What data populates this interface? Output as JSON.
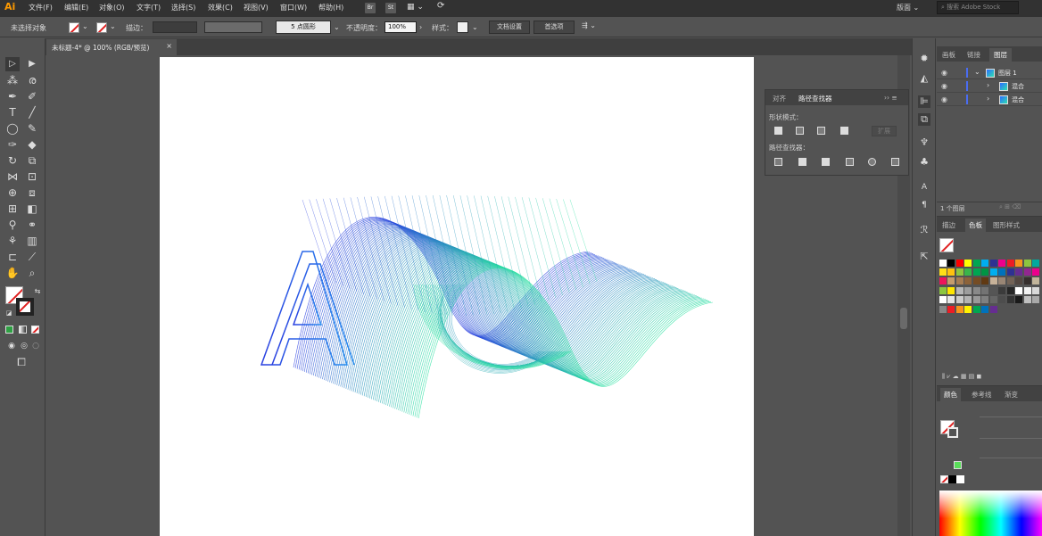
{
  "app": {
    "logo": "Ai"
  },
  "menu": {
    "items": [
      "文件(F)",
      "编辑(E)",
      "对象(O)",
      "文字(T)",
      "选择(S)",
      "效果(C)",
      "视图(V)",
      "窗口(W)",
      "帮助(H)"
    ],
    "badges": [
      "Br",
      "St"
    ],
    "workspace": "版面 ⌄",
    "search_placeholder": "搜索 Adobe Stock"
  },
  "control_bar": {
    "no_selection": "未选择对象",
    "stroke_label": "描边：",
    "brush_label": "5 点圆形",
    "opacity_label": "不透明度：",
    "opacity_value": "100%",
    "style_label": "样式：",
    "doc_setup_button": "文档设置",
    "prefs_button": "首选项"
  },
  "document": {
    "tab_title": "未标题-4* @ 100% (RGB/预览)",
    "close": "×",
    "gradient_start": "#2a3fe0",
    "gradient_end": "#29e0a0"
  },
  "pathfinder": {
    "tabs": [
      "对齐",
      "路径查找器"
    ],
    "shape_modes_label": "形状模式：",
    "pathfinders_label": "路径查找器：",
    "expand_button": "扩展",
    "menu_icons": "›› ≡"
  },
  "layers": {
    "tabs": [
      "画板",
      "链接",
      "图层"
    ],
    "rows": [
      {
        "name": "图层 1",
        "arrow": "⌄"
      },
      {
        "name": "混合",
        "arrow": "›"
      },
      {
        "name": "混合",
        "arrow": "›"
      }
    ],
    "count_label": "1 个图层"
  },
  "swatches": {
    "tabs": [
      "描边",
      "色板",
      "图形样式"
    ]
  },
  "color": {
    "tabs": [
      "颜色",
      "参考线",
      "渐变"
    ]
  }
}
